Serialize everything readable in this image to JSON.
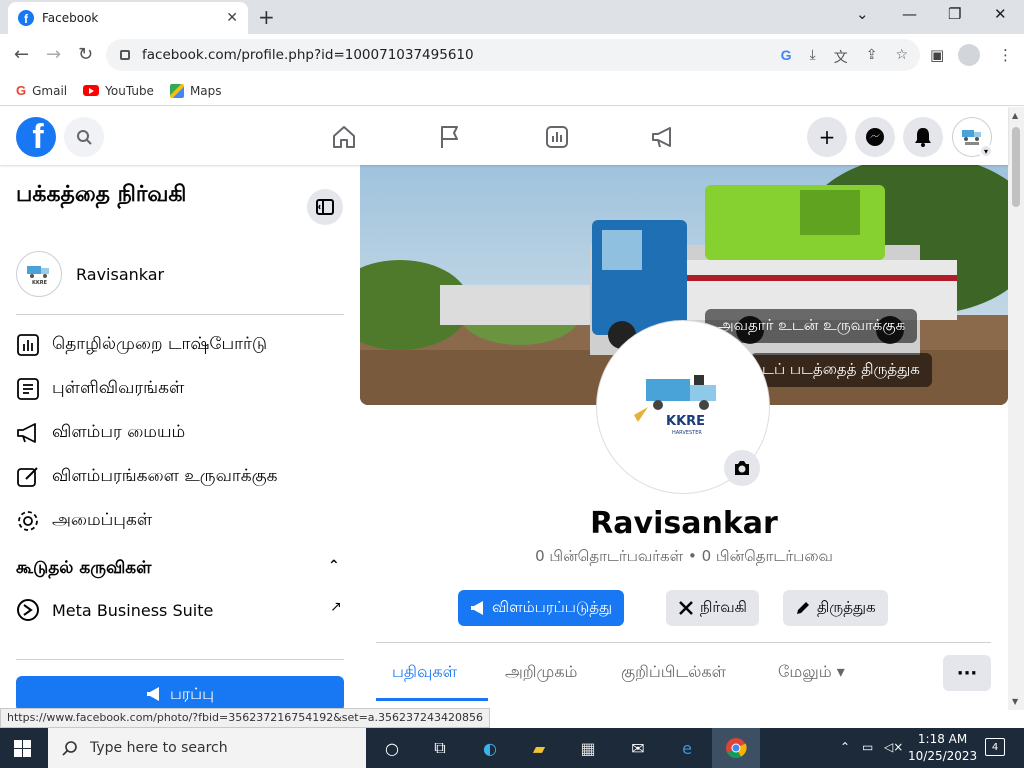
{
  "browser": {
    "tab_title": "Facebook",
    "url": "facebook.com/profile.php?id=100071037495610",
    "bookmarks": [
      "Gmail",
      "YouTube",
      "Maps"
    ],
    "status_link": "https://www.facebook.com/photo/?fbid=356237216754192&set=a.356237243420856"
  },
  "left_panel": {
    "title": "பக்கத்தை நிர்வகி",
    "page_name": "Ravisankar",
    "avatar_text": "KKRE",
    "items": [
      "தொழில்முறை டாஷ்போர்டு",
      "புள்ளிவிவரங்கள்",
      "விளம்பர மையம்",
      "விளம்பரங்களை உருவாக்குக",
      "அமைப்புகள்"
    ],
    "section_title": "கூடுதல் கருவிகள்",
    "meta_suite": "Meta Business Suite",
    "promote_label": "பரப்பு"
  },
  "profile": {
    "cover_buttons": [
      "அவதார் உடன் உருவாக்குக",
      "டப் படத்தைத் திருத்துக"
    ],
    "logo_text": "KKRE",
    "logo_sub": "HARVESTER",
    "name": "Ravisankar",
    "followers_line": "0 பின்தொடர்பவர்கள் • 0 பின்தொடர்பவை",
    "actions": [
      "விளம்பரப்படுத்து",
      "நிர்வகி",
      "திருத்துக"
    ],
    "tabs": [
      "பதிவுகள்",
      "அறிமுகம்",
      "குறிப்பிடல்கள்",
      "மேலும்"
    ]
  },
  "taskbar": {
    "search_placeholder": "Type here to search",
    "time": "1:18 AM",
    "date": "10/25/2023",
    "notifications": "4"
  },
  "colors": {
    "fb_blue": "#1877f2",
    "taskbar": "#1c2a3a",
    "secondary_btn": "#e4e6eb"
  },
  "icons": [
    "facebook-logo",
    "search-icon",
    "home-icon",
    "flag-icon",
    "insights-icon",
    "megaphone-icon",
    "plus-icon",
    "messenger-icon",
    "bell-icon",
    "camera-icon"
  ]
}
